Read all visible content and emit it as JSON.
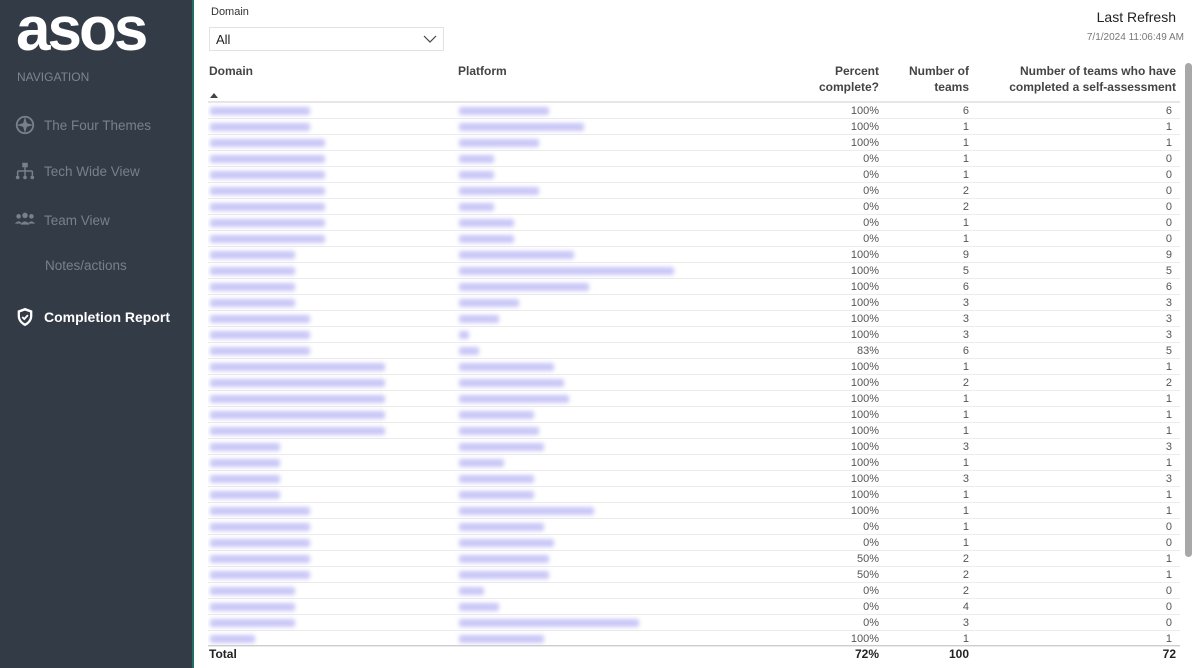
{
  "sidebar": {
    "logo": "asos",
    "nav_label": "NAVIGATION",
    "items": [
      {
        "label": "The Four Themes",
        "icon": "compass-icon"
      },
      {
        "label": "Tech Wide View",
        "icon": "hierarchy-icon"
      },
      {
        "label": "Team View",
        "icon": "team-icon"
      },
      {
        "label": "Notes/actions",
        "icon": ""
      },
      {
        "label": "Completion Report",
        "icon": "shield-check-icon",
        "active": true
      }
    ]
  },
  "filter": {
    "label": "Domain",
    "value": "All"
  },
  "refresh": {
    "title": "Last Refresh",
    "time": "7/1/2024 11:06:49 AM"
  },
  "table": {
    "headers": {
      "domain": "Domain",
      "platform": "Platform",
      "percent": [
        "Percent",
        "complete?"
      ],
      "teams": [
        "Number of",
        "teams"
      ],
      "completed": [
        "Number of teams who have",
        "completed a self-assessment"
      ]
    },
    "rows": [
      {
        "pct": "100%",
        "teams": "6",
        "done": "6"
      },
      {
        "pct": "100%",
        "teams": "1",
        "done": "1"
      },
      {
        "pct": "100%",
        "teams": "1",
        "done": "1"
      },
      {
        "pct": "0%",
        "teams": "1",
        "done": "0"
      },
      {
        "pct": "0%",
        "teams": "1",
        "done": "0"
      },
      {
        "pct": "0%",
        "teams": "2",
        "done": "0"
      },
      {
        "pct": "0%",
        "teams": "2",
        "done": "0"
      },
      {
        "pct": "0%",
        "teams": "1",
        "done": "0"
      },
      {
        "pct": "0%",
        "teams": "1",
        "done": "0"
      },
      {
        "pct": "100%",
        "teams": "9",
        "done": "9"
      },
      {
        "pct": "100%",
        "teams": "5",
        "done": "5"
      },
      {
        "pct": "100%",
        "teams": "6",
        "done": "6"
      },
      {
        "pct": "100%",
        "teams": "3",
        "done": "3"
      },
      {
        "pct": "100%",
        "teams": "3",
        "done": "3"
      },
      {
        "pct": "100%",
        "teams": "3",
        "done": "3"
      },
      {
        "pct": "83%",
        "teams": "6",
        "done": "5"
      },
      {
        "pct": "100%",
        "teams": "1",
        "done": "1"
      },
      {
        "pct": "100%",
        "teams": "2",
        "done": "2"
      },
      {
        "pct": "100%",
        "teams": "1",
        "done": "1"
      },
      {
        "pct": "100%",
        "teams": "1",
        "done": "1"
      },
      {
        "pct": "100%",
        "teams": "1",
        "done": "1"
      },
      {
        "pct": "100%",
        "teams": "3",
        "done": "3"
      },
      {
        "pct": "100%",
        "teams": "1",
        "done": "1"
      },
      {
        "pct": "100%",
        "teams": "3",
        "done": "3"
      },
      {
        "pct": "100%",
        "teams": "1",
        "done": "1"
      },
      {
        "pct": "100%",
        "teams": "1",
        "done": "1"
      },
      {
        "pct": "0%",
        "teams": "1",
        "done": "0"
      },
      {
        "pct": "0%",
        "teams": "1",
        "done": "0"
      },
      {
        "pct": "50%",
        "teams": "2",
        "done": "1"
      },
      {
        "pct": "50%",
        "teams": "2",
        "done": "1"
      },
      {
        "pct": "0%",
        "teams": "2",
        "done": "0"
      },
      {
        "pct": "0%",
        "teams": "4",
        "done": "0"
      },
      {
        "pct": "0%",
        "teams": "3",
        "done": "0"
      },
      {
        "pct": "100%",
        "teams": "1",
        "done": "1"
      }
    ],
    "total": {
      "label": "Total",
      "pct": "72%",
      "teams": "100",
      "done": "72"
    }
  }
}
